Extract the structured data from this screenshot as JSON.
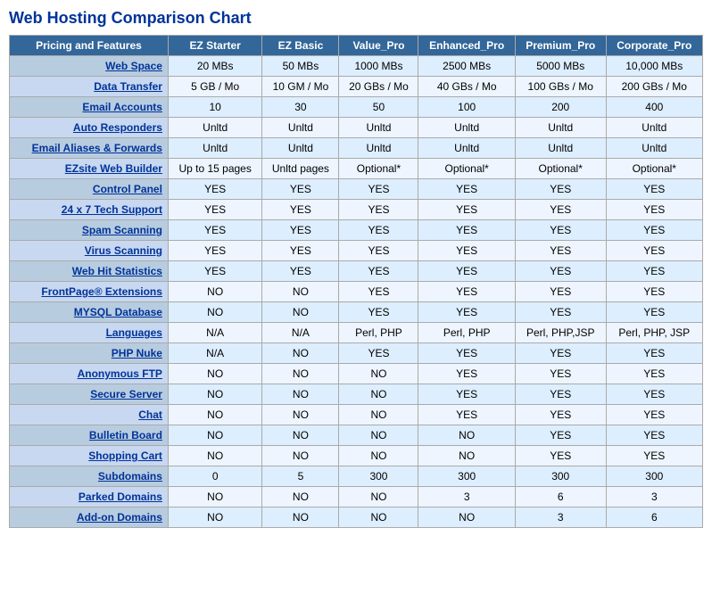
{
  "title": "Web Hosting Comparison Chart",
  "headers": [
    "Pricing and Features",
    "EZ Starter",
    "EZ Basic",
    "Value_Pro",
    "Enhanced_Pro",
    "Premium_Pro",
    "Corporate_Pro"
  ],
  "rows": [
    {
      "feature": "Web Space",
      "ez_starter": "20 MBs",
      "ez_basic": "50 MBs",
      "value_pro": "1000 MBs",
      "enhanced_pro": "2500 MBs",
      "premium_pro": "5000 MBs",
      "corporate_pro": "10,000 MBs"
    },
    {
      "feature": "Data Transfer",
      "ez_starter": "5 GB / Mo",
      "ez_basic": "10 GM / Mo",
      "value_pro": "20 GBs / Mo",
      "enhanced_pro": "40 GBs / Mo",
      "premium_pro": "100 GBs / Mo",
      "corporate_pro": "200 GBs / Mo"
    },
    {
      "feature": "Email Accounts",
      "ez_starter": "10",
      "ez_basic": "30",
      "value_pro": "50",
      "enhanced_pro": "100",
      "premium_pro": "200",
      "corporate_pro": "400"
    },
    {
      "feature": "Auto Responders",
      "ez_starter": "Unltd",
      "ez_basic": "Unltd",
      "value_pro": "Unltd",
      "enhanced_pro": "Unltd",
      "premium_pro": "Unltd",
      "corporate_pro": "Unltd"
    },
    {
      "feature": "Email Aliases & Forwards",
      "ez_starter": "Unltd",
      "ez_basic": "Unltd",
      "value_pro": "Unltd",
      "enhanced_pro": "Unltd",
      "premium_pro": "Unltd",
      "corporate_pro": "Unltd"
    },
    {
      "feature": "EZsite Web Builder",
      "ez_starter": "Up to 15 pages",
      "ez_basic": "Unltd pages",
      "value_pro": "Optional*",
      "enhanced_pro": "Optional*",
      "premium_pro": "Optional*",
      "corporate_pro": "Optional*"
    },
    {
      "feature": "Control Panel",
      "ez_starter": "YES",
      "ez_basic": "YES",
      "value_pro": "YES",
      "enhanced_pro": "YES",
      "premium_pro": "YES",
      "corporate_pro": "YES"
    },
    {
      "feature": "24 x 7 Tech Support",
      "ez_starter": "YES",
      "ez_basic": "YES",
      "value_pro": "YES",
      "enhanced_pro": "YES",
      "premium_pro": "YES",
      "corporate_pro": "YES"
    },
    {
      "feature": "Spam Scanning",
      "ez_starter": "YES",
      "ez_basic": "YES",
      "value_pro": "YES",
      "enhanced_pro": "YES",
      "premium_pro": "YES",
      "corporate_pro": "YES"
    },
    {
      "feature": "Virus Scanning",
      "ez_starter": "YES",
      "ez_basic": "YES",
      "value_pro": "YES",
      "enhanced_pro": "YES",
      "premium_pro": "YES",
      "corporate_pro": "YES"
    },
    {
      "feature": "Web Hit Statistics",
      "ez_starter": "YES",
      "ez_basic": "YES",
      "value_pro": "YES",
      "enhanced_pro": "YES",
      "premium_pro": "YES",
      "corporate_pro": "YES"
    },
    {
      "feature": "FrontPage® Extensions",
      "ez_starter": "NO",
      "ez_basic": "NO",
      "value_pro": "YES",
      "enhanced_pro": "YES",
      "premium_pro": "YES",
      "corporate_pro": "YES"
    },
    {
      "feature": "MYSQL Database",
      "ez_starter": "NO",
      "ez_basic": "NO",
      "value_pro": "YES",
      "enhanced_pro": "YES",
      "premium_pro": "YES",
      "corporate_pro": "YES"
    },
    {
      "feature": "Languages",
      "ez_starter": "N/A",
      "ez_basic": "N/A",
      "value_pro": "Perl, PHP",
      "enhanced_pro": "Perl, PHP",
      "premium_pro": "Perl, PHP,JSP",
      "corporate_pro": "Perl, PHP, JSP"
    },
    {
      "feature": "PHP Nuke",
      "ez_starter": "N/A",
      "ez_basic": "NO",
      "value_pro": "YES",
      "enhanced_pro": "YES",
      "premium_pro": "YES",
      "corporate_pro": "YES"
    },
    {
      "feature": "Anonymous FTP",
      "ez_starter": "NO",
      "ez_basic": "NO",
      "value_pro": "NO",
      "enhanced_pro": "YES",
      "premium_pro": "YES",
      "corporate_pro": "YES"
    },
    {
      "feature": "Secure Server",
      "ez_starter": "NO",
      "ez_basic": "NO",
      "value_pro": "NO",
      "enhanced_pro": "YES",
      "premium_pro": "YES",
      "corporate_pro": "YES"
    },
    {
      "feature": "Chat",
      "ez_starter": "NO",
      "ez_basic": "NO",
      "value_pro": "NO",
      "enhanced_pro": "YES",
      "premium_pro": "YES",
      "corporate_pro": "YES"
    },
    {
      "feature": "Bulletin Board",
      "ez_starter": "NO",
      "ez_basic": "NO",
      "value_pro": "NO",
      "enhanced_pro": "NO",
      "premium_pro": "YES",
      "corporate_pro": "YES"
    },
    {
      "feature": "Shopping Cart",
      "ez_starter": "NO",
      "ez_basic": "NO",
      "value_pro": "NO",
      "enhanced_pro": "NO",
      "premium_pro": "YES",
      "corporate_pro": "YES"
    },
    {
      "feature": "Subdomains",
      "ez_starter": "0",
      "ez_basic": "5",
      "value_pro": "300",
      "enhanced_pro": "300",
      "premium_pro": "300",
      "corporate_pro": "300"
    },
    {
      "feature": "Parked Domains",
      "ez_starter": "NO",
      "ez_basic": "NO",
      "value_pro": "NO",
      "enhanced_pro": "3",
      "premium_pro": "6",
      "corporate_pro": "3"
    },
    {
      "feature": "Add-on Domains",
      "ez_starter": "NO",
      "ez_basic": "NO",
      "value_pro": "NO",
      "enhanced_pro": "NO",
      "premium_pro": "3",
      "corporate_pro": "6"
    }
  ]
}
